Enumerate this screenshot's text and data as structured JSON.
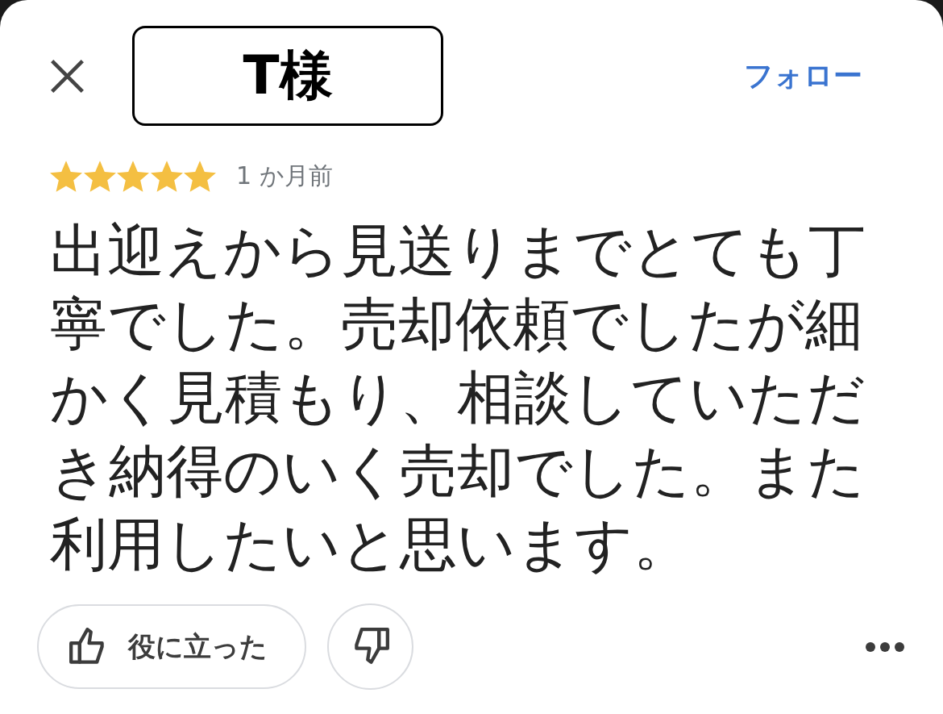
{
  "reviewer": {
    "name": "T様"
  },
  "follow_button": {
    "label": "フォロー"
  },
  "review": {
    "stars": 5,
    "time": "1 か月前",
    "text": "出迎えから見送りまでとても丁寧でした。売却依頼でしたが細かく見積もり、相談していただき納得のいく売却でした。また利用したいと思います。"
  },
  "actions": {
    "helpful_button": {
      "label": "役に立った"
    }
  }
}
